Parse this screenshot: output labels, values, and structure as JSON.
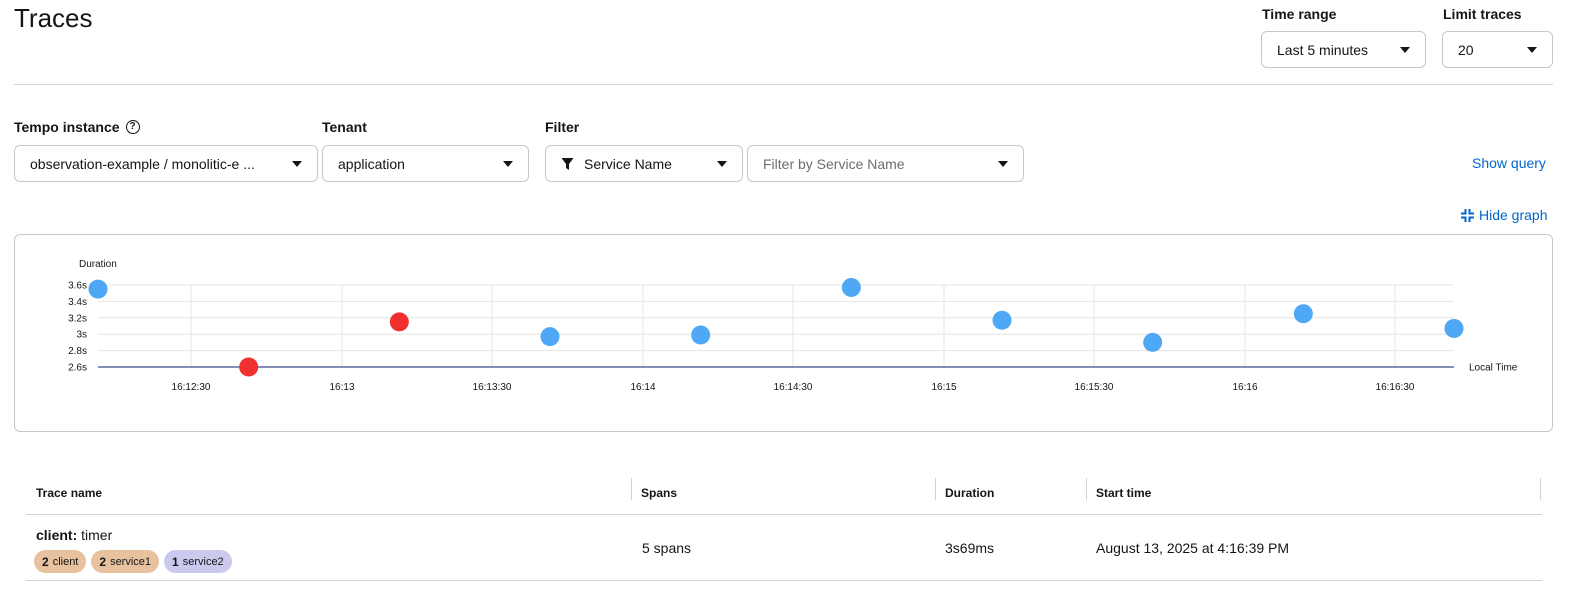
{
  "header": {
    "title": "Traces"
  },
  "controls": {
    "time_range": {
      "label": "Time range",
      "value": "Last 5 minutes"
    },
    "limit_traces": {
      "label": "Limit traces",
      "value": "20"
    }
  },
  "filters": {
    "tempo_instance": {
      "label": "Tempo instance",
      "value": "observation-example / monolitic-e ..."
    },
    "tenant": {
      "label": "Tenant",
      "value": "application"
    },
    "filter": {
      "label": "Filter",
      "attribute": "Service Name",
      "placeholder": "Filter by Service Name"
    },
    "show_query": "Show query",
    "hide_graph": "Hide graph"
  },
  "colors": {
    "ok": "#4fa8f5",
    "error": "#f0302f",
    "link": "#0066cc"
  },
  "chart_data": {
    "type": "scatter",
    "ylabel": "Duration",
    "xlabel": "Local Time",
    "y_ticks": [
      "2.6s",
      "2.8s",
      "3s",
      "3.2s",
      "3.4s",
      "3.6s"
    ],
    "y_range": [
      2.6,
      3.6
    ],
    "x_ticks": [
      "16:12:30",
      "16:13",
      "16:13:30",
      "16:14",
      "16:14:30",
      "16:15",
      "16:15:30",
      "16:16",
      "16:16:30"
    ],
    "x_range_seconds": [
      11,
      219
    ],
    "points": [
      {
        "t": 11,
        "duration": 3.55,
        "error": false
      },
      {
        "t": 41,
        "duration": 2.6,
        "error": true
      },
      {
        "t": 71,
        "duration": 3.15,
        "error": true
      },
      {
        "t": 101,
        "duration": 2.97,
        "error": false
      },
      {
        "t": 131,
        "duration": 2.99,
        "error": false
      },
      {
        "t": 161,
        "duration": 3.57,
        "error": false
      },
      {
        "t": 191,
        "duration": 3.17,
        "error": false
      },
      {
        "t": 221,
        "duration": 2.9,
        "error": false
      },
      {
        "t": 251,
        "duration": 3.25,
        "error": false
      },
      {
        "t": 281,
        "duration": 3.07,
        "error": false
      }
    ]
  },
  "table": {
    "columns": [
      "Trace name",
      "Spans",
      "Duration",
      "Start time"
    ],
    "rows": [
      {
        "service": "client:",
        "operation": "timer",
        "badges": [
          {
            "count": "2",
            "name": "client",
            "color": "#e8c29e"
          },
          {
            "count": "2",
            "name": "service1",
            "color": "#e8c29e"
          },
          {
            "count": "1",
            "name": "service2",
            "color": "#cbc9ee"
          }
        ],
        "spans": "5 spans",
        "duration": "3s69ms",
        "start_time": "August 13, 2025 at 4:16:39 PM"
      }
    ]
  }
}
